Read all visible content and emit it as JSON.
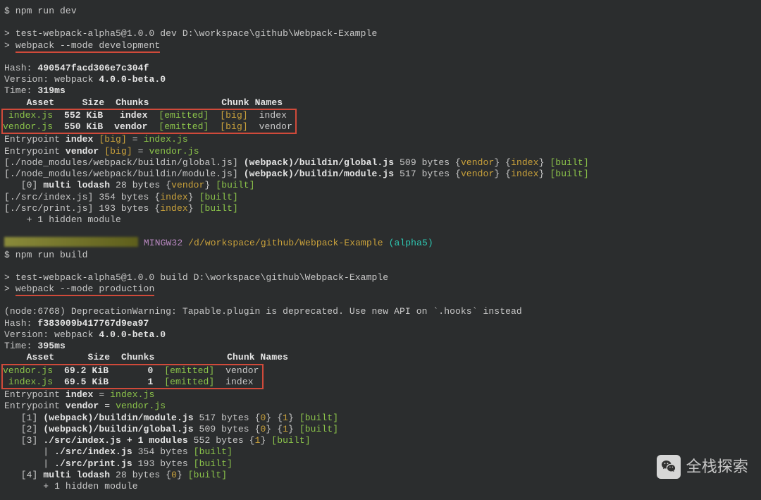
{
  "dev": {
    "cmd": "$ npm run dev",
    "script1": "> test-webpack-alpha5@1.0.0 dev D:\\workspace\\github\\Webpack-Example",
    "script2_prefix": "> ",
    "script2_body": "webpack --mode development",
    "hash_label": "Hash: ",
    "hash": "490547facd306e7c304f",
    "version_label": "Version: webpack ",
    "version": "4.0.0-beta.0",
    "time_label": "Time: ",
    "time": "319ms",
    "table_hdr_asset": "Asset",
    "table_hdr_size": "Size",
    "table_hdr_chunks": "Chunks",
    "table_hdr_cnames": "Chunk Names",
    "row1_asset": " index.js",
    "row1_size": "552 KiB",
    "row1_chunk": "index",
    "row1_emitted": "[emitted]",
    "row1_big": "[big]",
    "row1_name": "index",
    "row2_asset": "vendor.js",
    "row2_size": "550 KiB",
    "row2_chunk": "vendor",
    "row2_emitted": "[emitted]",
    "row2_big": "[big]",
    "row2_name": "vendor",
    "ep1a": "Entrypoint ",
    "ep1b": "index",
    "ep1c": " [big]",
    "ep1d": " = ",
    "ep1e": "index.js",
    "ep2a": "Entrypoint ",
    "ep2b": "vendor",
    "ep2c": " [big]",
    "ep2d": " = ",
    "ep2e": "vendor.js",
    "mod1a": "[./node_modules/webpack/buildin/global.js] ",
    "mod1b": "(webpack)/buildin/global.js",
    "mod1c": " 509 bytes {",
    "mod1v": "vendor",
    "mod1d": "} {",
    "mod1i": "index",
    "mod1e": "} ",
    "mod1f": "[built]",
    "mod2a": "[./node_modules/webpack/buildin/module.js] ",
    "mod2b": "(webpack)/buildin/module.js",
    "mod2c": " 517 bytes {",
    "mod3a": "   [0] ",
    "mod3b": "multi lodash",
    "mod3c": " 28 bytes {",
    "mod3v": "vendor",
    "mod3d": "} ",
    "mod3e": "[built]",
    "mod4a": "[./src/index.js] 354 bytes {",
    "mod4i": "index",
    "mod4b": "} ",
    "mod4c": "[built]",
    "mod5a": "[./src/print.js] 193 bytes {",
    "mod6": "    + 1 hidden module"
  },
  "prompt": {
    "sys": "MINGW32",
    "path": " /d/workspace/github/Webpack-Example ",
    "branch": "(alpha5)"
  },
  "build": {
    "cmd": "$ npm run build",
    "script1": "> test-webpack-alpha5@1.0.0 build D:\\workspace\\github\\Webpack-Example",
    "script2_prefix": "> ",
    "script2_body": "webpack --mode production",
    "warn": "(node:6768) DeprecationWarning: Tapable.plugin is deprecated. Use new API on `.hooks` instead",
    "hash_label": "Hash: ",
    "hash": "f383009b417767d9ea97",
    "version_label": "Version: webpack ",
    "version": "4.0.0-beta.0",
    "time_label": "Time: ",
    "time": "395ms",
    "table_hdr_asset": "Asset",
    "table_hdr_size": "Size",
    "table_hdr_chunks": "Chunks",
    "table_hdr_cnames": "Chunk Names",
    "row1_asset": "vendor.js",
    "row1_size": "69.2 KiB",
    "row1_chunk": "0",
    "row1_emitted": "[emitted]",
    "row1_name": "vendor",
    "row2_asset": " index.js",
    "row2_size": "69.5 KiB",
    "row2_chunk": "1",
    "row2_emitted": "[emitted]",
    "row2_name": "index",
    "ep1a": "Entrypoint ",
    "ep1b": "index",
    "ep1c": " = ",
    "ep1d": "index.js",
    "ep2a": "Entrypoint ",
    "ep2b": "vendor",
    "ep2c": " = ",
    "ep2d": "vendor.js",
    "m1a": "   [1] ",
    "m1b": "(webpack)/buildin/module.js",
    "m1c": " 517 bytes {",
    "m1d": "0",
    "m1e": "} {",
    "m1f": "1",
    "m1g": "} ",
    "m1h": "[built]",
    "m2a": "   [2] ",
    "m2b": "(webpack)/buildin/global.js",
    "m2c": " 509 bytes {",
    "m3a": "   [3] ",
    "m3b": "./src/index.js + 1 modules",
    "m3c": " 552 bytes {",
    "m3d": "1",
    "m3e": "} ",
    "m3f": "[built]",
    "m4a": "       | ",
    "m4b": "./src/index.js",
    "m4c": " 354 bytes ",
    "m4d": "[built]",
    "m5b": "./src/print.js",
    "m5c": " 193 bytes ",
    "m6a": "   [4] ",
    "m6b": "multi lodash",
    "m6c": " 28 bytes {",
    "m6d": "0",
    "m6e": "} ",
    "m6f": "[built]",
    "m7": "       + 1 hidden module"
  },
  "watermark": "全栈探索"
}
